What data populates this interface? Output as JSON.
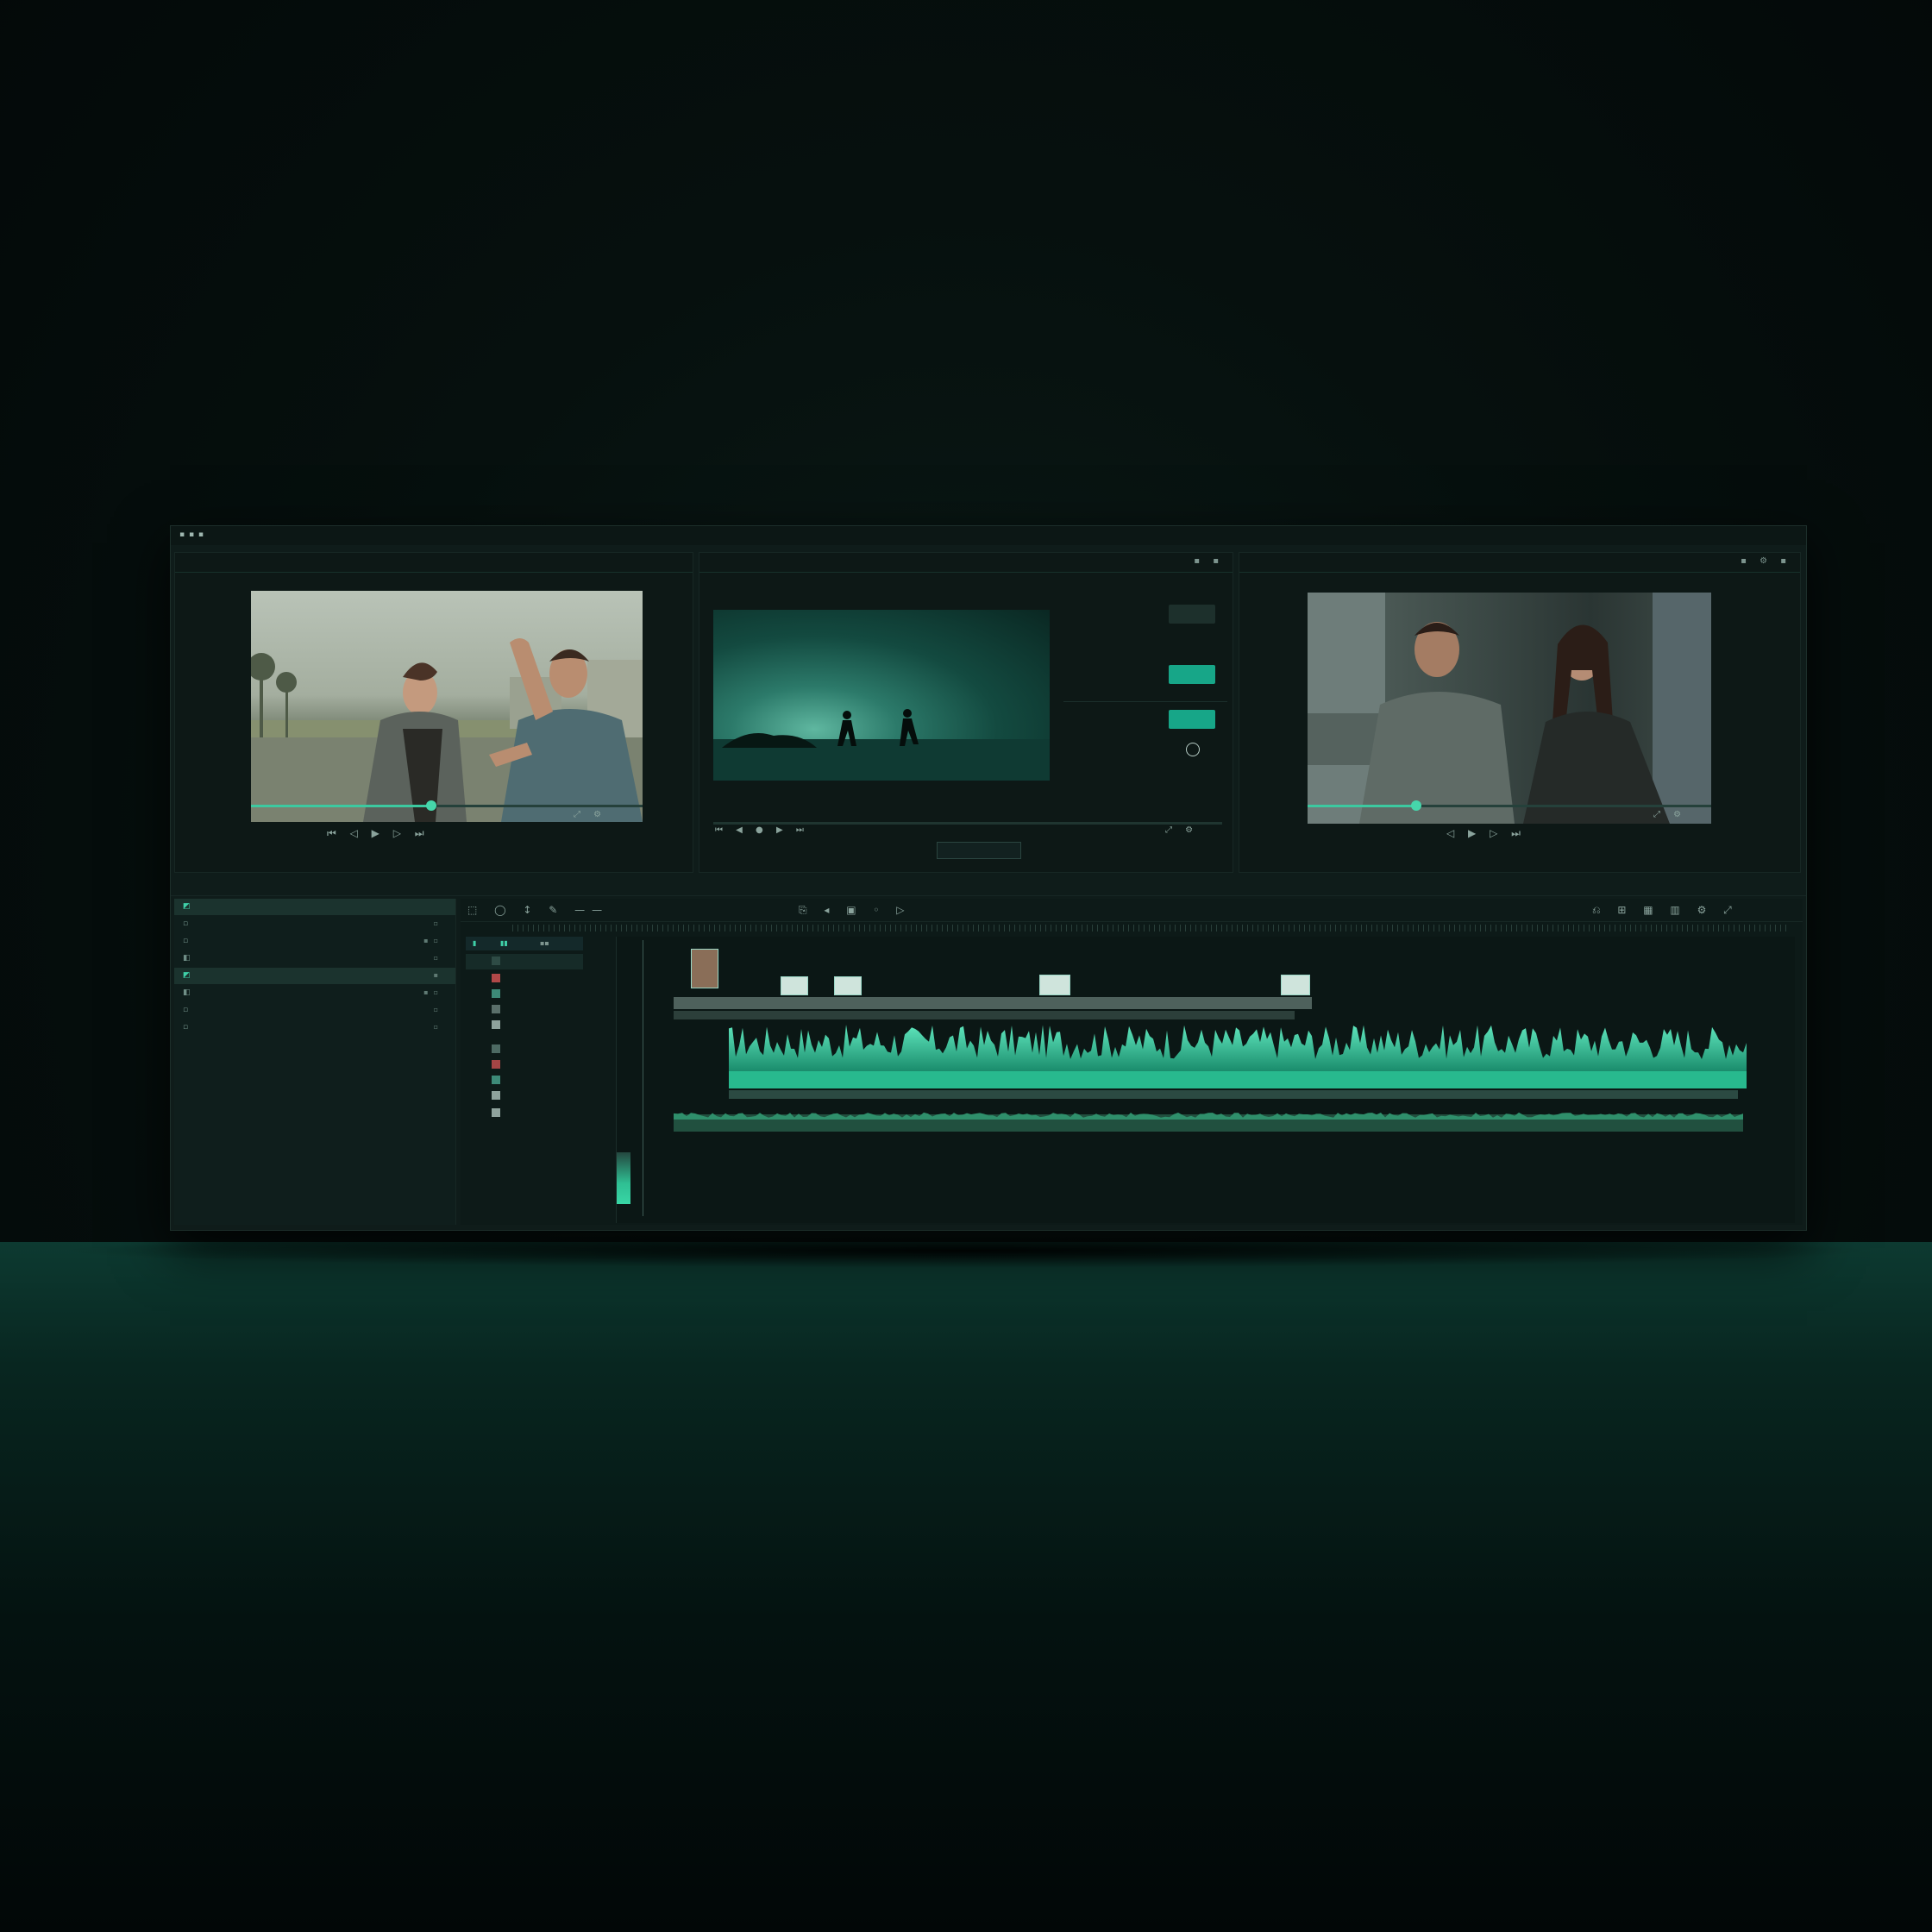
{
  "app": {
    "menu": "▪ ▪ ▪"
  },
  "colors": {
    "accent": "#3cc9a0",
    "background": "#0f1c1a",
    "panel": "#0d1816",
    "wave": "#36d3a5"
  },
  "viewers": {
    "left": {
      "title": "",
      "timecode_start": "",
      "transport": "⏮ ◁ ▶ ▷ ⏭",
      "progress": 0.46,
      "icons": "⤢ ⚙"
    },
    "middle": {
      "title": "",
      "transport": "⏮ ◀ ● ▶ ⏭",
      "render_label": "",
      "icons": "⤢ ⚙"
    },
    "right": {
      "title": "",
      "transport": "◁ ▶ ▷ ⏭",
      "progress": 0.27,
      "icons": "⤢ ⚙"
    }
  },
  "inspector": {
    "rows": [
      {
        "label": "",
        "button": "",
        "style": "dark"
      },
      {
        "label": "",
        "value": ""
      },
      {
        "label": "",
        "button": "",
        "style": "accent"
      },
      {
        "label": "",
        "button": "",
        "style": "accent"
      },
      {
        "label": "",
        "circle": true
      },
      {
        "label": "",
        "value": ""
      }
    ]
  },
  "project": {
    "items": [
      {
        "icon": "◩",
        "label": "",
        "selected": true
      },
      {
        "icon": "▫",
        "label": ""
      },
      {
        "icon": "▫",
        "label": ""
      },
      {
        "icon": "◧",
        "label": ""
      },
      {
        "icon": "◩",
        "label": "",
        "selected": true
      },
      {
        "icon": "◧",
        "label": ""
      },
      {
        "icon": "▫",
        "label": ""
      },
      {
        "icon": "▫",
        "label": ""
      }
    ]
  },
  "timeline": {
    "tools_left": "⬚ ◯ ↕ ✎ ——",
    "tools_mid": "⎘ ◂ ▣ ◦ ▷",
    "tools_right": "⎌ ⊞ ▦ ▥ ⚙ ⤢"
  }
}
